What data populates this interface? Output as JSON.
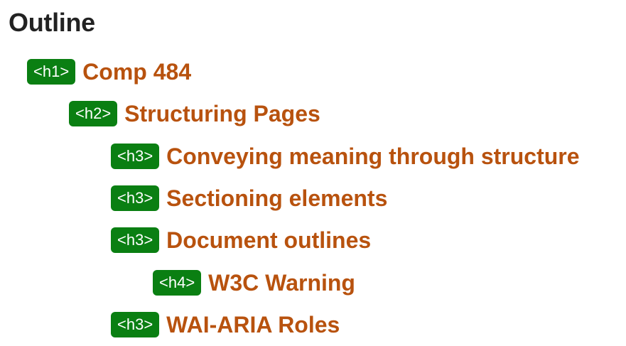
{
  "title": "Outline",
  "items": [
    {
      "tag": "<h1>",
      "label": "Comp 484"
    },
    {
      "tag": "<h2>",
      "label": "Structuring Pages"
    },
    {
      "tag": "<h3>",
      "label": "Conveying meaning through structure"
    },
    {
      "tag": "<h3>",
      "label": "Sectioning elements"
    },
    {
      "tag": "<h3>",
      "label": "Document outlines"
    },
    {
      "tag": "<h4>",
      "label": "W3C Warning"
    },
    {
      "tag": "<h3>",
      "label": "WAI-ARIA Roles"
    }
  ],
  "colors": {
    "badge_bg": "#0a7f12",
    "badge_text": "#ffffff",
    "link": "#b8520e",
    "title": "#222222"
  }
}
